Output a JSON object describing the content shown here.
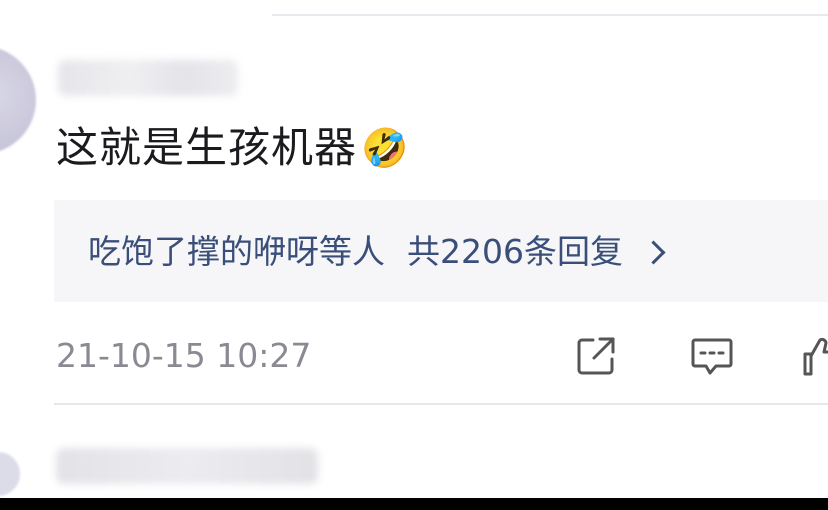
{
  "comment": {
    "text": "这就是生孩机器",
    "emoji": "🤣",
    "replies": {
      "names": "吃饱了撑的咿呀等人",
      "count_label": "共2206条回复"
    },
    "timestamp": "21-10-15 10:27",
    "actions": [
      "share-icon",
      "comment-icon",
      "like-icon"
    ]
  },
  "colors": {
    "link": "#3a4e7a",
    "muted": "#8a8a92",
    "text": "#1b1b1f",
    "reply_bg": "#f6f6f8"
  }
}
